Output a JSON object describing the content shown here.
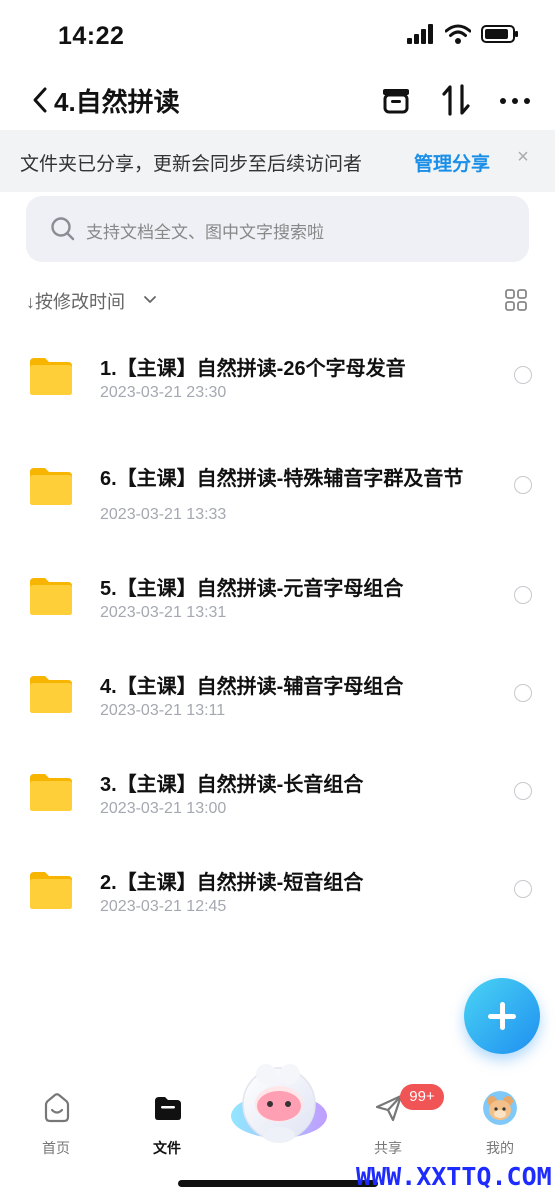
{
  "status_bar": {
    "time": "14:22"
  },
  "nav": {
    "title": "4.自然拼读"
  },
  "share_banner": {
    "text": "文件夹已分享，更新会同步至后续访问者",
    "link": "管理分享",
    "close": "×"
  },
  "search": {
    "placeholder": "支持文档全文、图中文字搜索啦"
  },
  "sort": {
    "label": "↓按修改时间"
  },
  "files": [
    {
      "name": "1.【主课】自然拼读-26个字母发音",
      "date": "2023-03-21 23:30"
    },
    {
      "name": "6.【主课】自然拼读-特殊辅音字群及音节",
      "date": "2023-03-21 13:33"
    },
    {
      "name": "5.【主课】自然拼读-元音字母组合",
      "date": "2023-03-21 13:31"
    },
    {
      "name": "4.【主课】自然拼读-辅音字母组合",
      "date": "2023-03-21 13:11"
    },
    {
      "name": "3.【主课】自然拼读-长音组合",
      "date": "2023-03-21 13:00"
    },
    {
      "name": "2.【主课】自然拼读-短音组合",
      "date": "2023-03-21 12:45"
    }
  ],
  "tabs": [
    {
      "label": "首页",
      "icon": "home-icon"
    },
    {
      "label": "文件",
      "icon": "folder-icon"
    },
    {
      "label": "共享",
      "icon": "send-icon",
      "badge": "99+"
    },
    {
      "label": "我的",
      "icon": "avatar"
    }
  ],
  "watermark": "WWW.XXTTQ.COM",
  "colors": {
    "accent": "#1a8fe8",
    "badge": "#f05454",
    "folder": "#ffc933"
  }
}
